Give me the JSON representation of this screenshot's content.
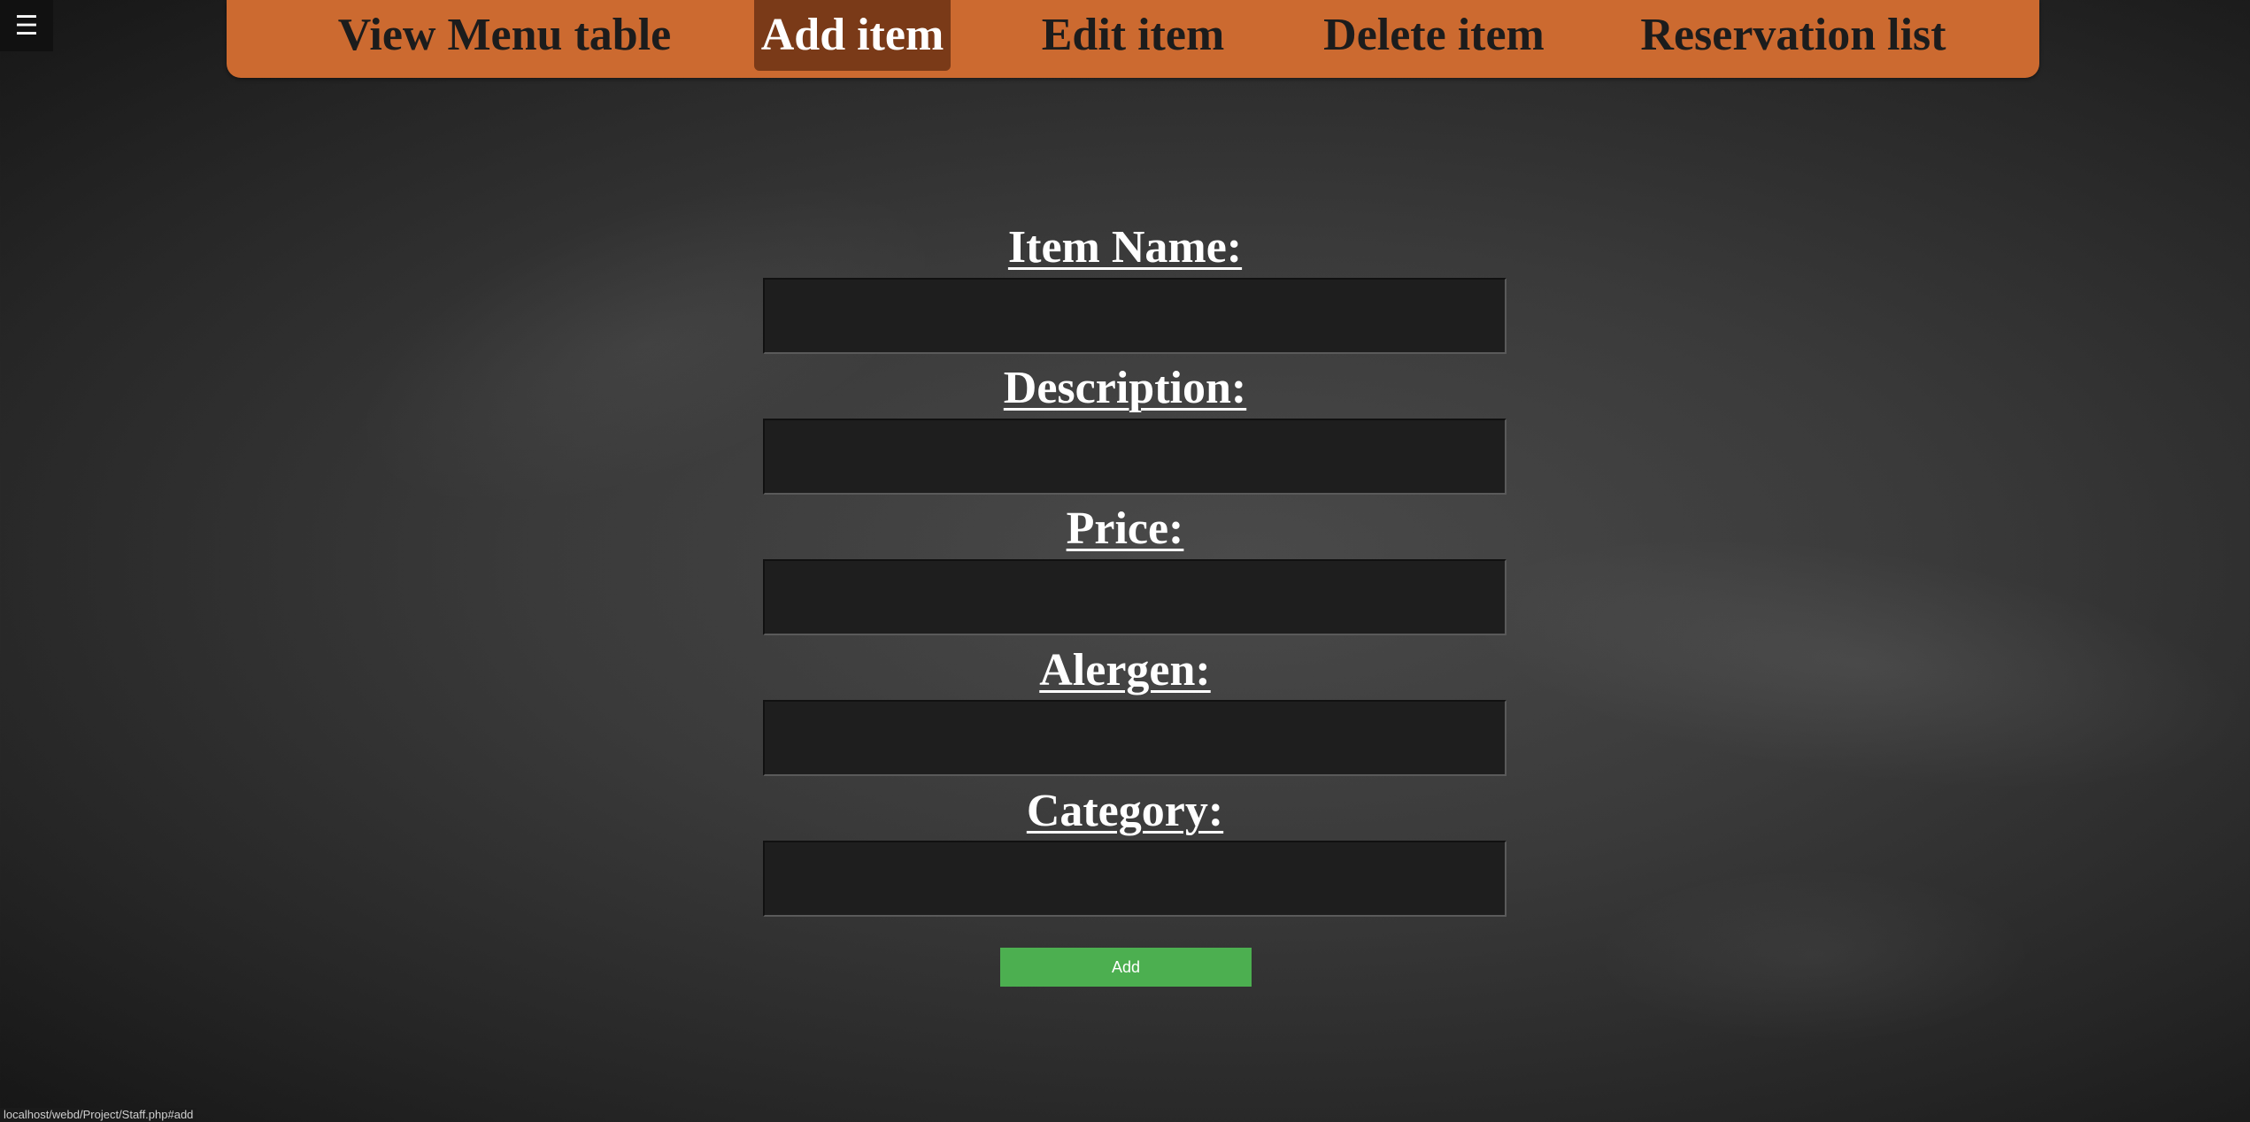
{
  "menu_toggle": {
    "icon": "hamburger-icon",
    "glyph": "☰"
  },
  "nav": {
    "items": [
      {
        "label": "View Menu table",
        "active": false
      },
      {
        "label": "Add item",
        "active": true
      },
      {
        "label": "Edit item",
        "active": false
      },
      {
        "label": "Delete item",
        "active": false
      },
      {
        "label": "Reservation list",
        "active": false
      }
    ]
  },
  "form": {
    "item_name_label": "Item Name:",
    "description_label": "Description:",
    "price_label": "Price:",
    "alergen_label": "Alergen:",
    "category_label": "Category:",
    "item_name_value": "",
    "description_value": "",
    "price_value": "",
    "alergen_value": "",
    "category_value": "",
    "add_label": "Add"
  },
  "status_bar": {
    "url": "localhost/webd/Project/Staff.php#add"
  },
  "colors": {
    "nav_background": "#cc6a30",
    "nav_active": "#7a3a18",
    "add_button": "#4caf50",
    "input_background": "#1e1e1e"
  }
}
